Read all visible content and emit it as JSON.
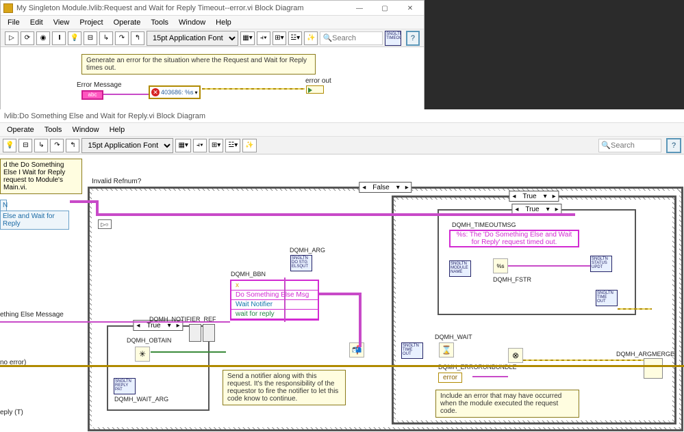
{
  "top": {
    "title": "My Singleton Module.lvlib:Request and Wait for Reply Timeout--error.vi Block Diagram",
    "menu": [
      "File",
      "Edit",
      "View",
      "Project",
      "Operate",
      "Tools",
      "Window",
      "Help"
    ],
    "font": "15pt Application Font",
    "search_ph": "Search",
    "help": "?",
    "winbtns": {
      "min": "—",
      "max": "▢",
      "close": "✕"
    },
    "comment": "Generate an error for the situation where the Request and Wait for Reply times out.",
    "err_msg_label": "Error Message",
    "err_code": "403686: %s",
    "err_out_label": "error out",
    "singleton_icon": "SNGLTN TIMEOUT"
  },
  "bot": {
    "title": "lvlib:Do Something Else and Wait for Reply.vi Block Diagram",
    "menu": [
      "Operate",
      "Tools",
      "Window",
      "Help"
    ],
    "font": "15pt Application Font",
    "search_ph": "Search",
    "help": "?",
    "invalid_label": "Invalid Refnum?",
    "outer_case": "False",
    "inner_case_r": "True",
    "inner_inner": "True",
    "comment1": "d the Do Something Else\nI Wait for Reply request to\nModule's Main.vi.",
    "cut_N": "N",
    "cut_blue": "Else and Wait for Reply",
    "cut_msg": "ething Else Message",
    "cut_noerr": "no error)",
    "cut_reply": "eply (T)",
    "left_case": "True",
    "dqmh_notifier": "DQMH_NOTIFIER_REF",
    "dqmh_obtain": "DQMH_OBTAIN",
    "dqmh_waitarg": "DQMH_WAIT_ARG",
    "dqmh_bbn": "DQMH_BBN",
    "dqmh_arg": "DQMH_ARG",
    "bbn_rows": [
      "x",
      "Do Something Else Msg",
      "Wait Notifier",
      "wait for reply"
    ],
    "comment2": "Send a notifier along with this request. It's the responsibility of the requestor to fire the notifier to let this code know to continue.",
    "dqmh_wait": "DQMH_WAIT",
    "dqmh_timeoutmsg": "DQMH_TIMEOUTMSG",
    "timeout_text": "%s: The 'Do Something Else and Wait for Reply' request timed out.",
    "dqmh_fstr": "DQMH_FSTR",
    "dqmh_errorunbundle": "DQMH_ERRORUNBUNDLE",
    "error_field": "error",
    "dqmh_argmerge": "DQMH_ARGMERGE",
    "comment3": "Include an error that may have occurred when the module executed the request code.",
    "vi_names": {
      "reply": "SNGLTN REPLY PAT",
      "module": "SNGLTN MODULE NAME",
      "status": "SNGLTN STATUS UPDT",
      "timeout": "SNGLTN TIME OUT",
      "dostg": "SNGLTN DO STG ELSQUT"
    }
  }
}
